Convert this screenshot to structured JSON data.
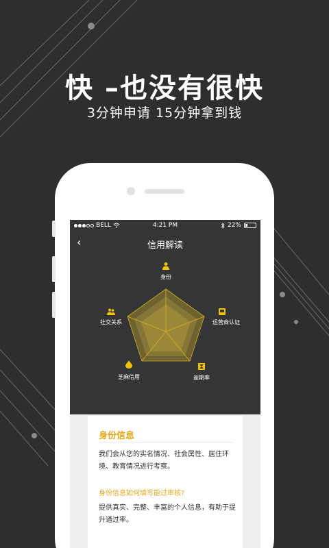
{
  "promo": {
    "headline": "快 –也没有很快",
    "subline": "3分钟申请 15分钟拿到钱"
  },
  "status_bar": {
    "carrier": "BELL",
    "time": "4:21 PM",
    "battery": "22%",
    "battery_level": 0.22
  },
  "nav": {
    "back": "‹",
    "title": "信用解读"
  },
  "radar": {
    "labels": {
      "identity": "身份",
      "carrier_auth": "运营商认证",
      "overdue_rate": "逾期率",
      "sesame_credit": "芝麻信用",
      "social": "社交关系"
    },
    "icons": [
      "person-icon",
      "sim-card-icon",
      "hourglass-icon",
      "drop-icon",
      "people-icon"
    ],
    "accent_color": "#f2c300"
  },
  "card": {
    "title": "身份信息",
    "body": "我们会从您的实名情况、社会属性、居住环境、教育情况进行考察。",
    "question": "身份信息如何填写能过审核?",
    "answer": "提供真实、完整、丰富的个人信息，有助于提升通过率。"
  }
}
